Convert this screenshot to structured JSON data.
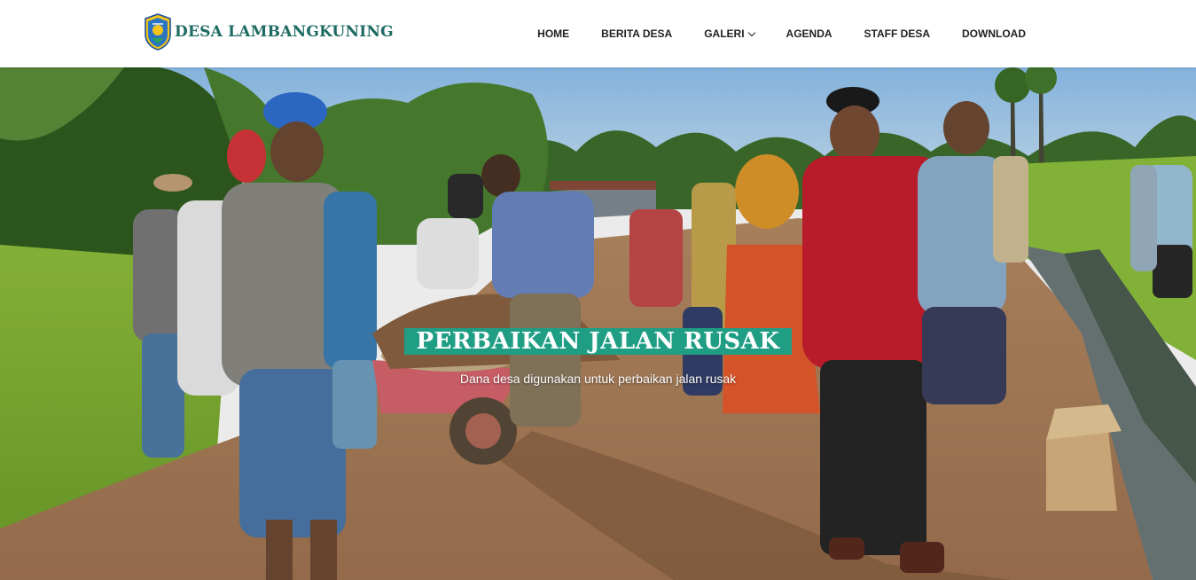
{
  "brand": {
    "name": "DESA LAMBANGKUNING",
    "logo_icon": "regency-emblem-icon"
  },
  "nav": {
    "items": [
      {
        "label": "HOME"
      },
      {
        "label": "BERITA DESA"
      },
      {
        "label": "GALERI",
        "has_dropdown": true
      },
      {
        "label": "AGENDA"
      },
      {
        "label": "STAFF DESA"
      },
      {
        "label": "DOWNLOAD"
      }
    ]
  },
  "hero": {
    "title": "PERBAIKAN JALAN RUSAK",
    "subtitle": "Dana desa digunakan untuk perbaikan jalan rusak",
    "title_bg_color": "#1f9e84"
  },
  "colors": {
    "brand_text": "#1d6b63",
    "menu_text": "#222222"
  }
}
